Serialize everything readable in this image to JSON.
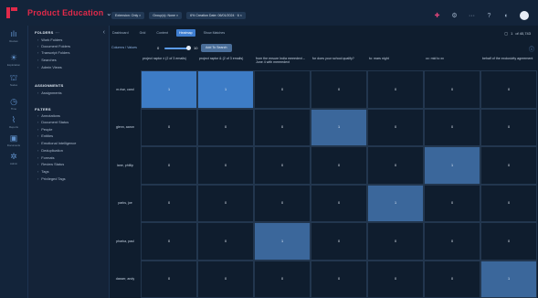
{
  "app": {
    "title": "Product Education",
    "title_caret": "⌄"
  },
  "topbar": {
    "chips": [
      "Extension: Only ×",
      "Group(s): None ×",
      "6% Creation Date: 06/01/2024 · 6 ×"
    ],
    "icons": [
      "grid-icon",
      "gear-icon",
      "more-icon",
      "help-icon",
      "moon-icon"
    ]
  },
  "rail": {
    "items": [
      {
        "icon": "ılı",
        "label": "Review"
      },
      {
        "icon": "☀",
        "label": "Exploration"
      },
      {
        "icon": "⛫",
        "label": "Nodes"
      },
      {
        "icon": "◷",
        "label": "Time"
      },
      {
        "icon": "⌇",
        "label": "Reports"
      },
      {
        "icon": "▣",
        "label": "Documents"
      },
      {
        "icon": "✲",
        "label": "Admin"
      }
    ]
  },
  "panel": {
    "collapse": "‹",
    "folders_title": "FOLDERS",
    "folders_dots": "···",
    "folders": [
      "Work Folders",
      "Document Folders",
      "Transcript Folders",
      "Searches",
      "Admin Views"
    ],
    "assignments_title": "ASSIGNMENTS",
    "assignments": [
      "Assignments"
    ],
    "filters_title": "FILTERS",
    "filters": [
      "Annotations",
      "Document Status",
      "People",
      "Entities",
      "Emotional Intelligence",
      "Deduplication",
      "Formats",
      "Review Status",
      "Tags",
      "Privileged Tags"
    ]
  },
  "main": {
    "tabs": [
      "Dashboard",
      "Grid",
      "Content",
      "Heatmap",
      "Show Matches"
    ],
    "active_tab": "Heatmap",
    "right_tools": {
      "page_of": "of 40,743",
      "pages_label": "1"
    },
    "controls": {
      "label": "Columns / Values",
      "min": "0",
      "max": "10",
      "add_button": "Add To Search"
    }
  },
  "heatmap": {
    "columns": [
      "project raptor ± (2 of 3 emails)",
      "project raptor & (2 of 3 emails)",
      "from the ensure India meeedext – June 4 with meeeedext",
      "for does your school qualify?",
      "to: mars night",
      "cc: mid to xx",
      "behalf of the exclusivity agreement"
    ],
    "rows": [
      {
        "label": "m.rise, carol",
        "values": [
          "1",
          "1",
          "0",
          "0",
          "0",
          "0",
          "0"
        ],
        "hi": [
          1,
          1,
          0,
          0,
          0,
          0,
          0
        ]
      },
      {
        "label": "glenn, aaron",
        "values": [
          "0",
          "0",
          "0",
          "1",
          "0",
          "0",
          "0"
        ],
        "hi": [
          0,
          0,
          0,
          2,
          0,
          0,
          0
        ]
      },
      {
        "label": "lane, phillip",
        "values": [
          "0",
          "0",
          "0",
          "0",
          "0",
          "1",
          "0"
        ],
        "hi": [
          0,
          0,
          0,
          0,
          0,
          2,
          0
        ]
      },
      {
        "label": "parks, joe",
        "values": [
          "0",
          "0",
          "0",
          "0",
          "1",
          "0",
          "0"
        ],
        "hi": [
          0,
          0,
          0,
          0,
          2,
          0,
          0
        ]
      },
      {
        "label": "pharka, paul",
        "values": [
          "0",
          "0",
          "1",
          "0",
          "0",
          "0",
          "0"
        ],
        "hi": [
          0,
          0,
          2,
          0,
          0,
          0,
          0
        ]
      },
      {
        "label": "dasser, andy",
        "values": [
          "0",
          "0",
          "0",
          "0",
          "0",
          "0",
          "1"
        ],
        "hi": [
          0,
          0,
          0,
          0,
          0,
          0,
          2
        ]
      }
    ]
  },
  "colors": {
    "accent": "#3f7ed0",
    "brand": "#e02a4a",
    "cell_high": "#3d7cc6",
    "cell_mid": "#3b679b"
  }
}
